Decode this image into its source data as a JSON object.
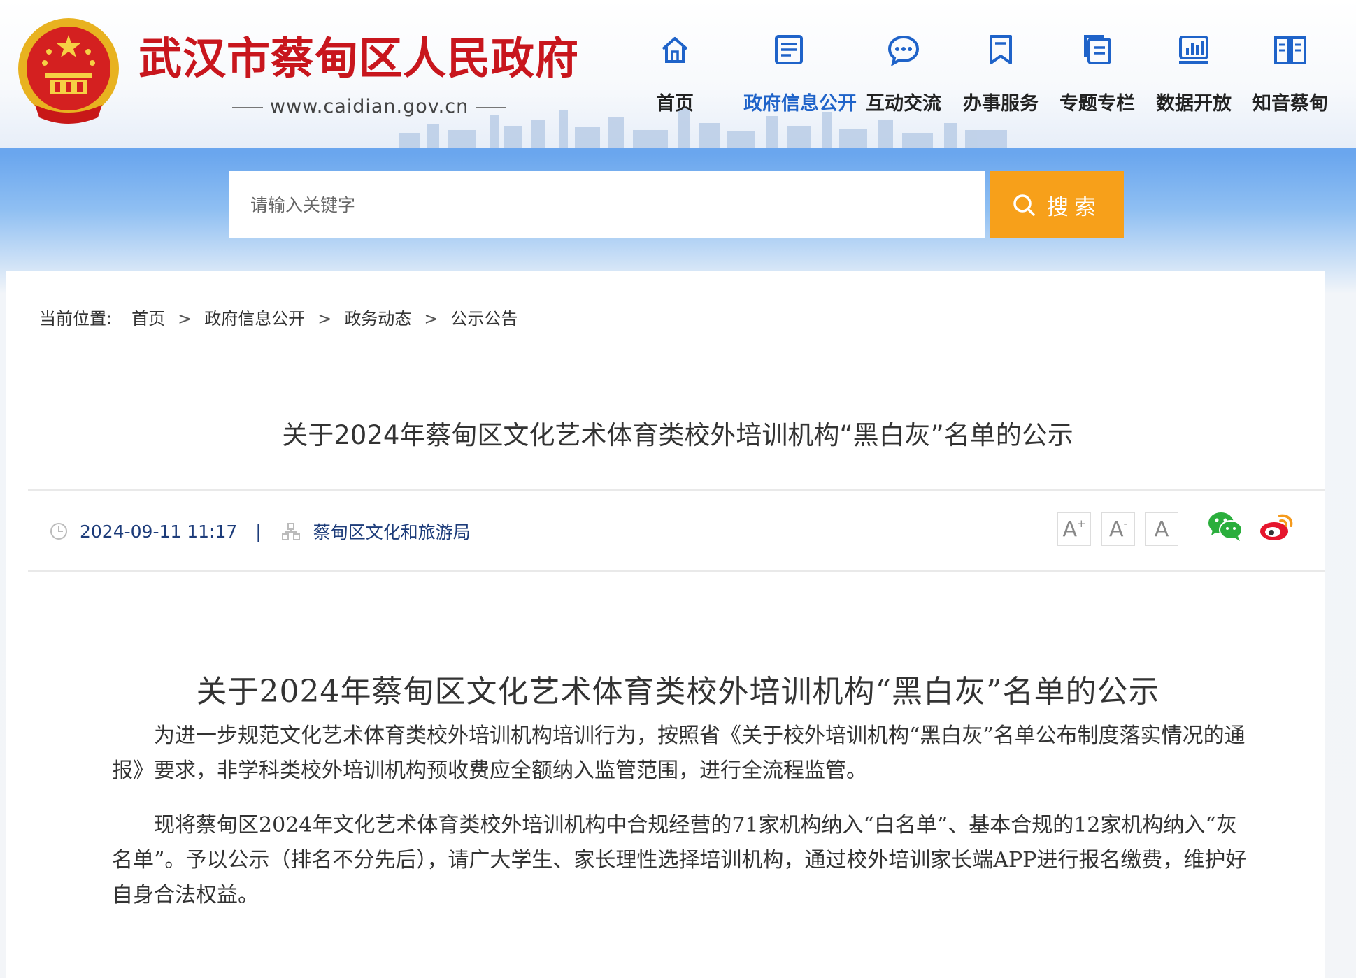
{
  "header": {
    "title": "武汉市蔡甸区人民政府",
    "url": "www.caidian.gov.cn"
  },
  "nav": {
    "items": [
      {
        "label": "首页",
        "icon": "home-icon"
      },
      {
        "label": "政府信息公开",
        "icon": "document-icon",
        "active": true
      },
      {
        "label": "互动交流",
        "icon": "chat-icon"
      },
      {
        "label": "办事服务",
        "icon": "bookmark-icon"
      },
      {
        "label": "专题专栏",
        "icon": "pages-icon"
      },
      {
        "label": "数据开放",
        "icon": "chart-icon"
      },
      {
        "label": "知音蔡甸",
        "icon": "book-icon"
      }
    ]
  },
  "search": {
    "placeholder": "请输入关键字",
    "button_label": "搜索"
  },
  "breadcrumb": {
    "here_label": "当前位置:",
    "items": [
      "首页",
      "政府信息公开",
      "政务动态",
      "公示公告"
    ],
    "separator": ">"
  },
  "page": {
    "title": "关于2024年蔡甸区文化艺术体育类校外培训机构“黑白灰”名单的公示"
  },
  "meta": {
    "date": "2024-09-11 11:17",
    "divider": "|",
    "source": "蔡甸区文化和旅游局"
  },
  "font_controls": {
    "increase": "A",
    "increase_mark": "+",
    "decrease": "A",
    "decrease_mark": "-",
    "reset": "A"
  },
  "share": {
    "items": [
      "wechat-icon",
      "weibo-icon"
    ]
  },
  "article": {
    "title": "关于2024年蔡甸区文化艺术体育类校外培训机构“黑白灰”名单的公示",
    "paragraphs": [
      "为进一步规范文化艺术体育类校外培训机构培训行为，按照省《关于校外培训机构“黑白灰”名单公布制度落实情况的通报》要求，非学科类校外培训机构预收费应全额纳入监管范围，进行全流程监管。",
      "现将蔡甸区2024年文化艺术体育类校外培训机构中合规经营的71家机构纳入“白名单”、基本合规的12家机构纳入“灰名单”。予以公示（排名不分先后），请广大学生、家长理性选择培训机构，通过校外培训家长端APP进行报名缴费，维护好自身合法权益。"
    ]
  },
  "colors": {
    "brand_red": "#c8161d",
    "nav_active": "#1f63c9",
    "search_button": "#f7a01a",
    "banner_blue": "#6aa6ee",
    "meta_text": "#1d3c7a"
  }
}
